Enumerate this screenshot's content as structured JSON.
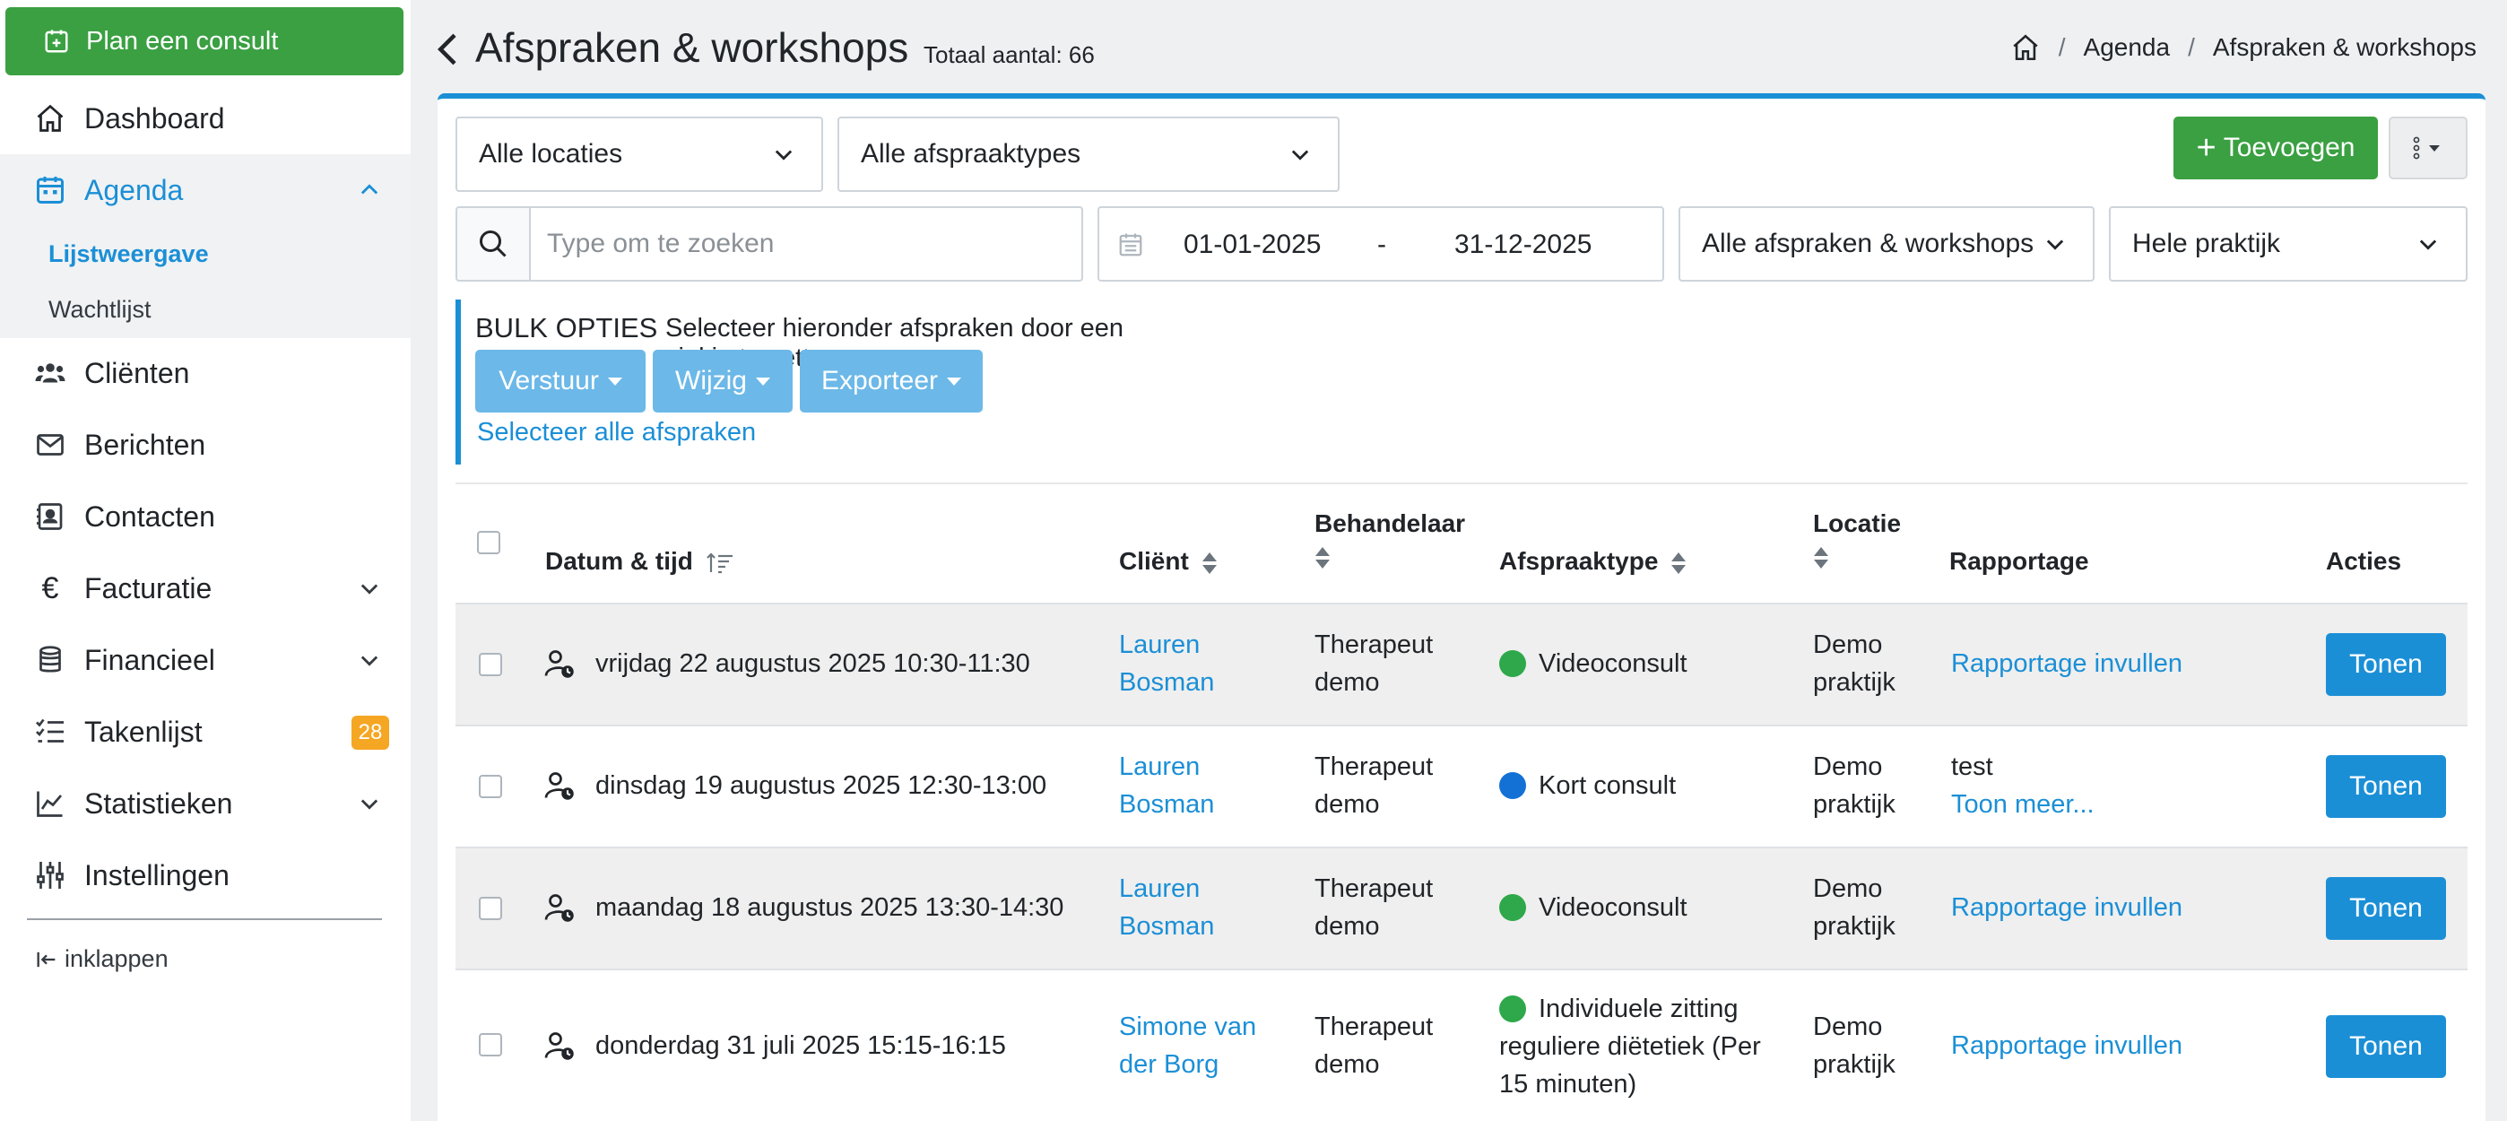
{
  "sidebar": {
    "plan_button": "Plan een consult",
    "items": [
      {
        "label": "Dashboard"
      },
      {
        "label": "Agenda"
      },
      {
        "label": "Cliënten"
      },
      {
        "label": "Berichten"
      },
      {
        "label": "Contacten"
      },
      {
        "label": "Facturatie"
      },
      {
        "label": "Financieel"
      },
      {
        "label": "Takenlijst",
        "badge": "28"
      },
      {
        "label": "Statistieken"
      },
      {
        "label": "Instellingen"
      }
    ],
    "agenda_sub": [
      "Lijstweergave",
      "Wachtlijst"
    ],
    "collapse": "inklappen",
    "accent_color": "#1b8fd6",
    "green_color": "#3aa042",
    "badge_color": "#f5a623"
  },
  "header": {
    "title": "Afspraken & workshops",
    "total": "Totaal aantal: 66",
    "breadcrumb": [
      "Agenda",
      "Afspraken & workshops"
    ],
    "breadcrumb_sep": "/"
  },
  "filters": {
    "locations": "Alle locaties",
    "types": "Alle afspraaktypes",
    "add": "Toevoegen",
    "search_placeholder": "Type om te zoeken",
    "date_from": "01-01-2025",
    "date_sep": "-",
    "date_to": "31-12-2025",
    "kind": "Alle afspraken & workshops",
    "scope": "Hele praktijk"
  },
  "bulk": {
    "title": "BULK OPTIES",
    "description": "Selecteer hieronder afspraken door een vinkje te zetten",
    "send": "Verstuur",
    "edit": "Wijzig",
    "export": "Exporteer",
    "select_all": "Selecteer alle afspraken"
  },
  "table": {
    "headers": {
      "date": "Datum & tijd",
      "client": "Cliënt",
      "practitioner": "Behandelaar",
      "type": "Afspraaktype",
      "location": "Locatie",
      "report": "Rapportage",
      "actions": "Acties"
    },
    "rows": [
      {
        "date": "vrijdag 22 augustus 2025 10:30-11:30",
        "client_1": "Lauren",
        "client_2": "Bosman",
        "pract_1": "Therapeut",
        "pract_2": "demo",
        "type_1": "Videoconsult",
        "type_2": "",
        "type_3": "",
        "type_color": "#2ea84a",
        "loc_1": "Demo",
        "loc_2": "praktijk",
        "report_1": "Rapportage invullen",
        "report_2": "",
        "action": "Tonen"
      },
      {
        "date": "dinsdag 19 augustus 2025 12:30-13:00",
        "client_1": "Lauren",
        "client_2": "Bosman",
        "pract_1": "Therapeut",
        "pract_2": "demo",
        "type_1": "Kort consult",
        "type_2": "",
        "type_3": "",
        "type_color": "#1371d6",
        "loc_1": "Demo",
        "loc_2": "praktijk",
        "report_1": "test",
        "report_2": "Toon meer...",
        "action": "Tonen"
      },
      {
        "date": "maandag 18 augustus 2025 13:30-14:30",
        "client_1": "Lauren",
        "client_2": "Bosman",
        "pract_1": "Therapeut",
        "pract_2": "demo",
        "type_1": "Videoconsult",
        "type_2": "",
        "type_3": "",
        "type_color": "#2ea84a",
        "loc_1": "Demo",
        "loc_2": "praktijk",
        "report_1": "Rapportage invullen",
        "report_2": "",
        "action": "Tonen"
      },
      {
        "date": "donderdag 31 juli 2025 15:15-16:15",
        "client_1": "Simone van",
        "client_2": "der Borg",
        "pract_1": "Therapeut",
        "pract_2": "demo",
        "type_1": "Individuele zitting",
        "type_2": "reguliere diëtetiek (Per",
        "type_3": "15 minuten)",
        "type_color": "#2ea84a",
        "loc_1": "Demo",
        "loc_2": "praktijk",
        "report_1": "Rapportage invullen",
        "report_2": "",
        "action": "Tonen"
      }
    ]
  }
}
